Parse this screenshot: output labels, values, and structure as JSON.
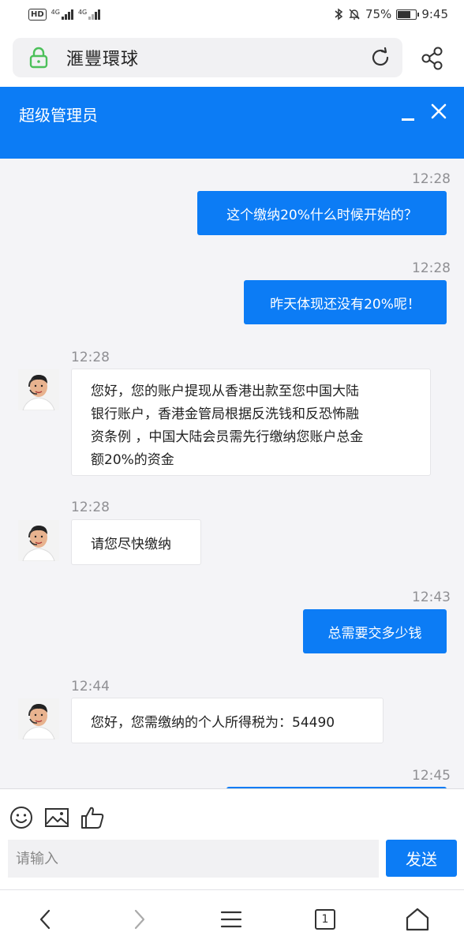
{
  "status_bar": {
    "hd_badge": "HD",
    "network_1": "4G",
    "network_2": "4G",
    "battery_percent": "75%",
    "battery_level": 0.75,
    "time": "9:45"
  },
  "browser": {
    "site_title": "滙豐環球"
  },
  "chat": {
    "title": "超级管理员",
    "messages": [
      {
        "side": "out",
        "time": "12:28",
        "text": "这个缴纳20%什么时候开始的？"
      },
      {
        "side": "out",
        "time": "12:28",
        "text": "昨天体现还没有20%呢！"
      },
      {
        "side": "in",
        "time": "12:28",
        "lines": [
          "您好，您的账户提现从香港出款至您中国大陆",
          "银行账户，香港金管局根据反洗钱和反恐怖融",
          "资条例 ，中国大陆会员需先行缴纳您账户总金",
          "额20%的资金"
        ]
      },
      {
        "side": "in",
        "time": "12:28",
        "text": "请您尽快缴纳"
      },
      {
        "side": "out",
        "time": "12:43",
        "text": "总需要交多少钱"
      },
      {
        "side": "in",
        "time": "12:44",
        "text": "您好，您需缴纳的个人所得税为：54490"
      },
      {
        "side": "out",
        "time": "12:45",
        "text": ""
      }
    ]
  },
  "composer": {
    "placeholder": "请输入",
    "send_label": "发送"
  },
  "browser_nav": {
    "tab_count": "1"
  }
}
